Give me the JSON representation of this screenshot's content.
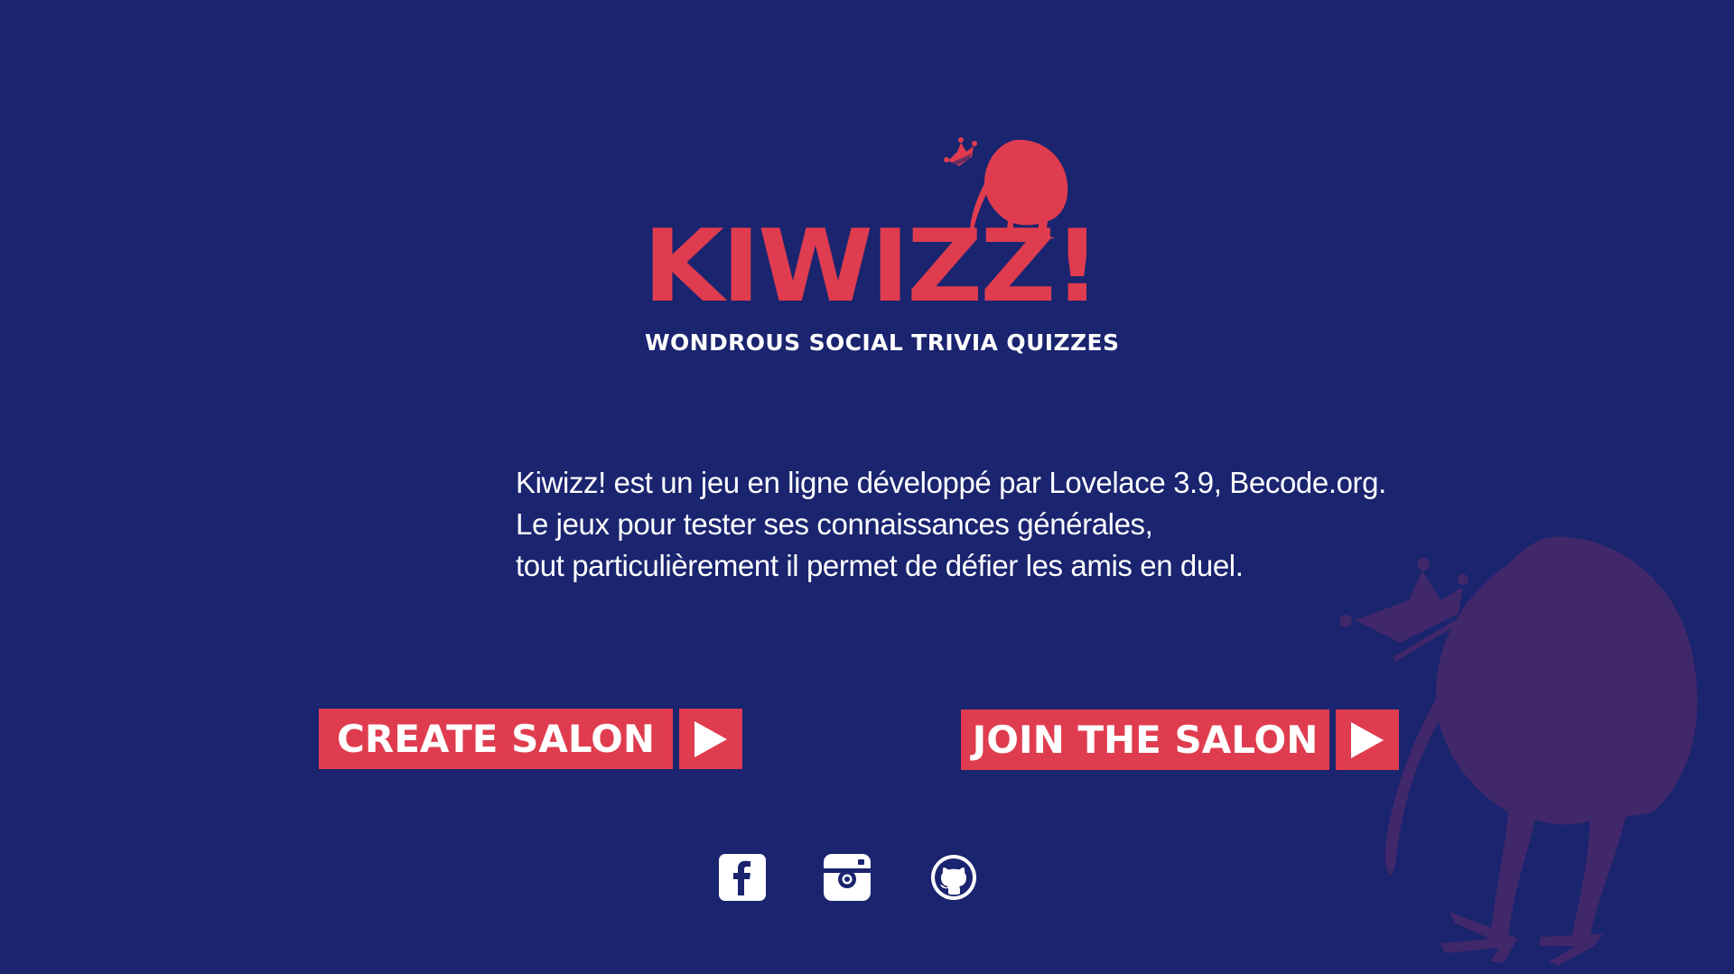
{
  "colors": {
    "background": "#1a246f",
    "accent": "#e03c4f",
    "decorative_kiwi": "#40286a",
    "text": "#ffffff"
  },
  "logo": {
    "wordmark": "KiWiZZ!",
    "tagline": "WONDROUS SOCIAL TRIVIA QUIZZES",
    "mascot": "crowned-kiwi-icon"
  },
  "description": {
    "lines": [
      "Kiwizz! est un jeu en ligne développé par Lovelace 3.9, Becode.org.",
      "Le jeux pour tester ses connaissances générales,",
      "tout particulièrement il permet de défier les amis en duel."
    ]
  },
  "buttons": {
    "create": {
      "label": "CREATE SALON",
      "icon": "play-arrow-icon"
    },
    "join": {
      "label": "JOIN THE SALON",
      "icon": "play-arrow-icon"
    }
  },
  "social": [
    {
      "name": "facebook",
      "icon": "facebook-icon"
    },
    {
      "name": "instagram",
      "icon": "instagram-icon"
    },
    {
      "name": "github",
      "icon": "github-icon"
    }
  ]
}
